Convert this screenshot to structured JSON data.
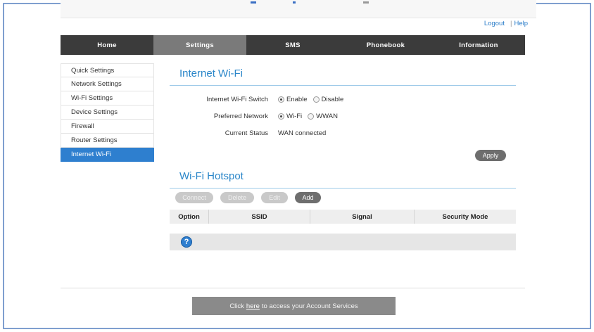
{
  "header": {
    "logout": "Logout",
    "separator": "|",
    "help": "Help"
  },
  "nav": {
    "items": [
      "Home",
      "Settings",
      "SMS",
      "Phonebook",
      "Information"
    ],
    "active": "Settings"
  },
  "sidebar": {
    "items": [
      "Quick Settings",
      "Network Settings",
      "Wi-Fi Settings",
      "Device Settings",
      "Firewall",
      "Router Settings",
      "Internet Wi-Fi"
    ],
    "active": "Internet Wi-Fi"
  },
  "internet_wifi": {
    "title": "Internet Wi-Fi",
    "switch_label": "Internet Wi-Fi Switch",
    "switch_options": [
      "Enable",
      "Disable"
    ],
    "switch_selected": "Enable",
    "preferred_label": "Preferred Network",
    "preferred_options": [
      "Wi-Fi",
      "WWAN"
    ],
    "preferred_selected": "Wi-Fi",
    "status_label": "Current Status",
    "status_value": "WAN connected",
    "apply": "Apply"
  },
  "hotspot": {
    "title": "Wi-Fi Hotspot",
    "buttons": {
      "connect": "Connect",
      "delete": "Delete",
      "edit": "Edit",
      "add": "Add"
    },
    "columns": [
      "Option",
      "SSID",
      "Signal",
      "Security Mode"
    ],
    "help_glyph": "?"
  },
  "footer": {
    "prefix": "Click",
    "link": "here",
    "suffix": "to access your Account Services"
  },
  "colors": {
    "accent": "#2e7fcf",
    "nav_bg": "#3b3b3b",
    "nav_active": "#7a7a7a",
    "frame": "#7f9fcf"
  }
}
